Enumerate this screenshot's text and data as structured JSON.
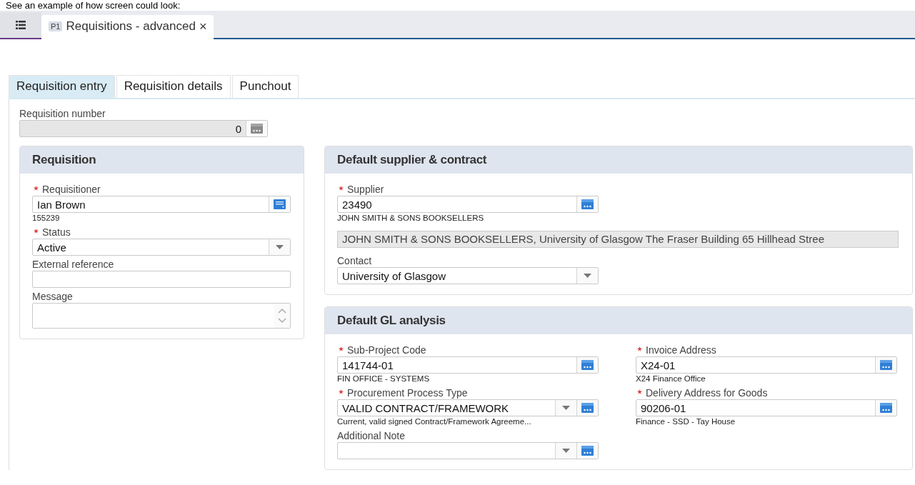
{
  "top_note": "See an example of how screen could look:",
  "app_tabs": [
    {
      "badge": "P1",
      "label": "Requisitions - advanced",
      "close": "×",
      "selected": true
    }
  ],
  "form_tabs": [
    {
      "label": "Requisition entry",
      "selected": true
    },
    {
      "label": "Requisition details",
      "selected": false
    },
    {
      "label": "Punchout",
      "selected": false
    }
  ],
  "requisition_number": {
    "label": "Requisition number",
    "value": "0",
    "disabled": true
  },
  "cards": [
    {
      "title": "Requisition",
      "columns": [
        [
          {
            "kind": "user_lookup",
            "label": "Requisitioner",
            "required": true,
            "value": "Ian Brown",
            "description": "155239"
          },
          {
            "kind": "select",
            "label": "Status",
            "required": true,
            "value": "Active"
          },
          {
            "kind": "text",
            "label": "External reference",
            "required": false
          },
          {
            "kind": "textarea",
            "label": "Message",
            "required": false
          }
        ]
      ]
    },
    {
      "title": "Default supplier & contract",
      "columns": [
        [
          {
            "kind": "lookup",
            "label": "Supplier",
            "required": true,
            "value": "23490",
            "description": "JOHN SMITH & SONS BOOKSELLERS"
          },
          {
            "kind": "readonly",
            "value": "JOHN SMITH & SONS BOOKSELLERS, University of Glasgow The Fraser Building 65 Hillhead Stree"
          },
          {
            "kind": "select",
            "label": "Contact",
            "required": false,
            "value": "University of Glasgow"
          }
        ]
      ]
    },
    {
      "title": "Default GL analysis",
      "columns": [
        [
          {
            "kind": "lookup",
            "label": "Sub-Project Code",
            "required": true,
            "value": "141744-01",
            "description": "FIN OFFICE - SYSTEMS"
          },
          {
            "kind": "select_lookup",
            "label": "Procurement Process Type",
            "required": true,
            "value": "VALID CONTRACT/FRAMEWORK",
            "description": "Current, valid signed Contract/Framework Agreeme..."
          },
          {
            "kind": "select_lookup",
            "label": "Additional Note",
            "required": false
          }
        ],
        [
          {
            "kind": "lookup",
            "label": "Invoice Address",
            "required": true,
            "value": "X24-01",
            "description": "X24 Finance Office"
          },
          {
            "kind": "lookup",
            "label": "Delivery Address for Goods",
            "required": true,
            "value": "90206-01",
            "description": "Finance - SSD - Tay House"
          }
        ]
      ]
    }
  ]
}
